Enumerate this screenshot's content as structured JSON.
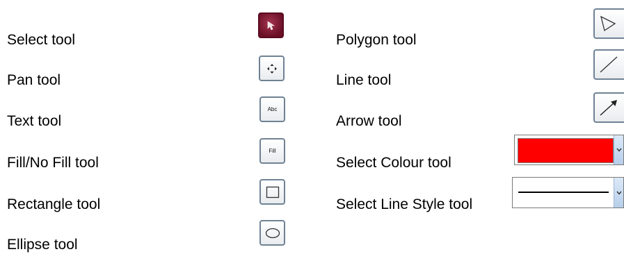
{
  "left_column": [
    {
      "label": "Select tool",
      "icon": "cursor-arrow-icon"
    },
    {
      "label": "Pan tool",
      "icon": "move-arrows-icon"
    },
    {
      "label": "Text tool",
      "icon": "text-abc-icon",
      "icon_text": "Abc"
    },
    {
      "label": "Fill/No Fill tool",
      "icon": "fill-icon",
      "icon_text": "Fill"
    },
    {
      "label": "Rectangle tool",
      "icon": "rectangle-icon"
    },
    {
      "label": "Ellipse tool",
      "icon": "ellipse-icon"
    }
  ],
  "right_column": [
    {
      "label": "Polygon tool",
      "icon": "polygon-icon"
    },
    {
      "label": "Line tool",
      "icon": "line-icon"
    },
    {
      "label": "Arrow tool",
      "icon": "arrow-icon"
    },
    {
      "label": "Select Colour tool",
      "icon": "colour-dropdown",
      "selected_colour": "#ff0000"
    },
    {
      "label": "Select Line Style tool",
      "icon": "line-style-dropdown",
      "selected_style": "solid"
    }
  ],
  "colors": {
    "select_active": "#7a1430",
    "button_border": "#6f8294",
    "colour_swatch": "#ff0000"
  }
}
